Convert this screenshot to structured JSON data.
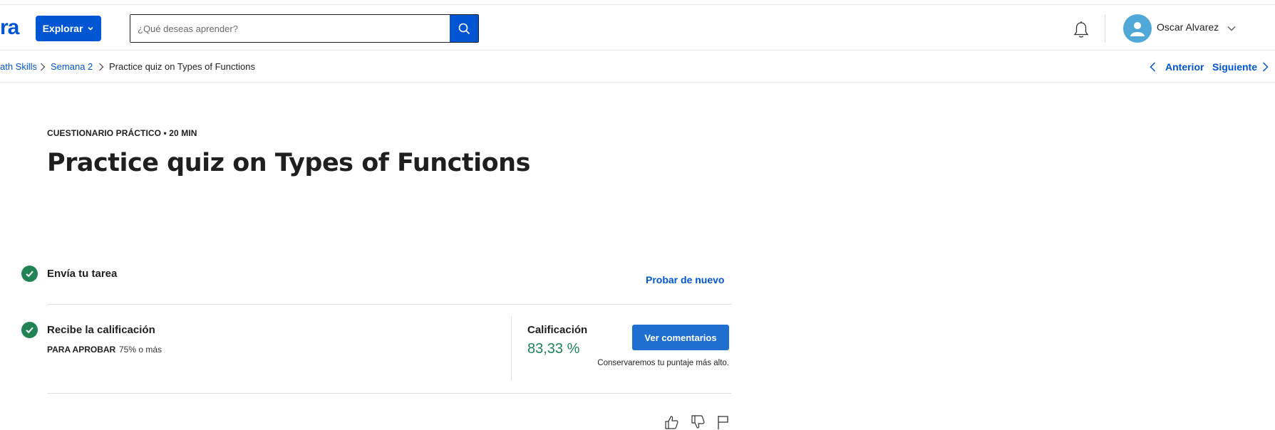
{
  "brand": {
    "logo_text": "ra",
    "accent": "#0056d2",
    "success": "#1f8354"
  },
  "header": {
    "explore_label": "Explorar",
    "search_placeholder": "¿Qué deseas aprender?",
    "user_name": "Oscar Alvarez",
    "icons": [
      "chevron-down-icon",
      "search-icon",
      "bell-icon",
      "avatar-icon"
    ]
  },
  "breadcrumb": {
    "items": [
      "ath Skills",
      "Semana 2",
      "Practice quiz on Types of Functions"
    ],
    "prev_label": "Anterior",
    "next_label": "Siguiente"
  },
  "main": {
    "item_type": "CUESTIONARIO PRÁCTICO • 20 MIN",
    "title": "Practice quiz on Types of Functions",
    "submit_step": {
      "title": "Envía tu tarea",
      "action": "Probar de nuevo"
    },
    "grade_step": {
      "title": "Recibe la calificación",
      "pass_label": "PARA APROBAR",
      "pass_value": "75% o más",
      "grade_label": "Calificación",
      "grade_value": "83,33 %",
      "feedback_button": "Ver comentarios",
      "keep_note": "Conservaremos tu puntaje más alto."
    },
    "feedback_icons": [
      "thumbs-up-icon",
      "thumbs-down-icon",
      "flag-icon"
    ]
  }
}
